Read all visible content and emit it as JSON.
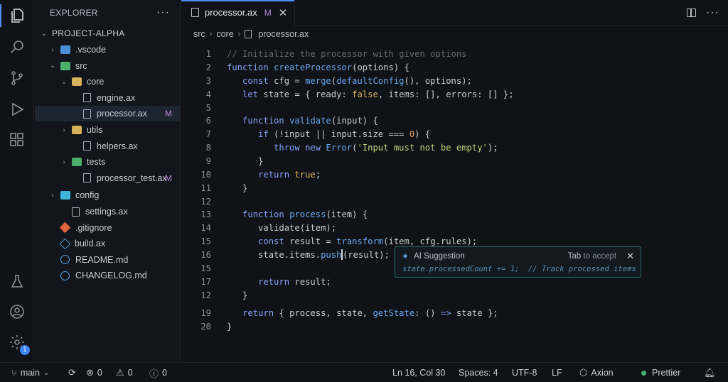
{
  "activity_bar": {
    "icons": [
      "files-icon",
      "search-icon",
      "source-control-icon",
      "run-debug-icon",
      "extensions-icon",
      "testing-icon",
      "account-icon",
      "settings-icon"
    ],
    "settings_badge": "1"
  },
  "sidebar": {
    "title": "EXPLORER",
    "more": "···",
    "project": "PROJECT-ALPHA",
    "items": [
      {
        "label": ".vscode",
        "kind": "folder",
        "color": "#4a90d9",
        "depth": 1,
        "open": false,
        "status": ""
      },
      {
        "label": "src",
        "kind": "folder",
        "color": "#4caf6a",
        "depth": 1,
        "open": true,
        "status": ""
      },
      {
        "label": "core",
        "kind": "folder",
        "color": "#d6b35a",
        "depth": 2,
        "open": true,
        "status": ""
      },
      {
        "label": "engine.ax",
        "kind": "file",
        "depth": 3,
        "status": ""
      },
      {
        "label": "processor.ax",
        "kind": "file",
        "depth": 3,
        "status": "M",
        "selected": true
      },
      {
        "label": "utils",
        "kind": "folder",
        "color": "#d6b35a",
        "depth": 2,
        "open": false,
        "status": ""
      },
      {
        "label": "helpers.ax",
        "kind": "file",
        "depth": 3,
        "status": ""
      },
      {
        "label": "tests",
        "kind": "folder",
        "color": "#4caf6a",
        "depth": 2,
        "open": false,
        "status": ""
      },
      {
        "label": "processor_test.ax",
        "kind": "file",
        "depth": 3,
        "status": "M"
      },
      {
        "label": "config",
        "kind": "folder",
        "color": "#3fb6d9",
        "depth": 1,
        "open": false,
        "status": ""
      },
      {
        "label": "settings.ax",
        "kind": "file",
        "depth": 2,
        "status": ""
      },
      {
        "label": ".gitignore",
        "kind": "git",
        "depth": 1,
        "status": ""
      },
      {
        "label": "build.ax",
        "kind": "build",
        "depth": 1,
        "status": ""
      },
      {
        "label": "README.md",
        "kind": "info",
        "depth": 1,
        "status": ""
      },
      {
        "label": "CHANGELOG.md",
        "kind": "info",
        "depth": 1,
        "status": ""
      }
    ]
  },
  "editor": {
    "tab": {
      "label": "processor.ax",
      "status": "M",
      "close": "✕"
    },
    "breadcrumb": [
      "src",
      "core",
      "processor.ax"
    ],
    "lines": [
      {
        "n": "1",
        "tokens": [
          [
            "com",
            "// Initialize the processor with given options"
          ]
        ]
      },
      {
        "n": "2",
        "tokens": [
          [
            "kw",
            "function "
          ],
          [
            "fn",
            "createProcessor"
          ],
          [
            "ct",
            "(options) {"
          ]
        ]
      },
      {
        "n": "3",
        "tokens": [
          [
            "ct",
            "   "
          ],
          [
            "kw",
            "const "
          ],
          [
            "ct",
            "cfg = "
          ],
          [
            "fn",
            "merge"
          ],
          [
            "ct",
            "("
          ],
          [
            "fn",
            "defaultConfig"
          ],
          [
            "ct",
            "(), options);"
          ]
        ]
      },
      {
        "n": "4",
        "tokens": [
          [
            "ct",
            "   "
          ],
          [
            "kw",
            "let "
          ],
          [
            "ct",
            "state = { ready: "
          ],
          [
            "bool",
            "false"
          ],
          [
            "ct",
            ", items: [], errors: [] };"
          ]
        ]
      },
      {
        "n": "5",
        "tokens": []
      },
      {
        "n": "6",
        "tokens": [
          [
            "ct",
            "   "
          ],
          [
            "kw",
            "function "
          ],
          [
            "fn",
            "validate"
          ],
          [
            "ct",
            "(input) {"
          ]
        ]
      },
      {
        "n": "7",
        "tokens": [
          [
            "ct",
            "      "
          ],
          [
            "kw",
            "if "
          ],
          [
            "ct",
            "(!input || input.size === "
          ],
          [
            "num",
            "0"
          ],
          [
            "ct",
            ") {"
          ]
        ]
      },
      {
        "n": "8",
        "tokens": [
          [
            "ct",
            "         "
          ],
          [
            "kw",
            "throw new "
          ],
          [
            "fn",
            "Error"
          ],
          [
            "ct",
            "("
          ],
          [
            "str",
            "'Input must not be empty'"
          ],
          [
            "ct",
            ");"
          ]
        ]
      },
      {
        "n": "9",
        "tokens": [
          [
            "ct",
            "      }"
          ]
        ]
      },
      {
        "n": "10",
        "tokens": [
          [
            "ct",
            "      "
          ],
          [
            "kw",
            "return "
          ],
          [
            "bool",
            "true"
          ],
          [
            "ct",
            ";"
          ]
        ]
      },
      {
        "n": "11",
        "tokens": [
          [
            "ct",
            "   }"
          ]
        ]
      },
      {
        "n": "12",
        "tokens": []
      },
      {
        "n": "13",
        "tokens": [
          [
            "ct",
            "   "
          ],
          [
            "kw",
            "function "
          ],
          [
            "fn",
            "process"
          ],
          [
            "ct",
            "(item) {"
          ]
        ]
      },
      {
        "n": "14",
        "tokens": [
          [
            "ct",
            "      validate(item);"
          ]
        ]
      },
      {
        "n": "15",
        "tokens": [
          [
            "ct",
            "      "
          ],
          [
            "kw",
            "const "
          ],
          [
            "ct",
            "result = "
          ],
          [
            "fn",
            "transform"
          ],
          [
            "ct",
            "(item, cfg.rules);"
          ]
        ]
      },
      {
        "n": "16",
        "tokens": [
          [
            "ct",
            "      state.items."
          ],
          [
            "fn",
            "push"
          ],
          [
            "cursor",
            ""
          ],
          [
            "ct",
            "(result);"
          ]
        ]
      },
      {
        "n": "15",
        "tokens": []
      },
      {
        "n": "17",
        "tokens": [
          [
            "ct",
            "      "
          ],
          [
            "kw",
            "return "
          ],
          [
            "ct",
            "result;"
          ]
        ]
      },
      {
        "n": "12",
        "tokens": [
          [
            "ct",
            "   }"
          ]
        ]
      },
      {
        "n": "19",
        "tokens": [
          [
            "ct",
            "   "
          ],
          [
            "kw",
            "return "
          ],
          [
            "ct",
            "{ process, state, "
          ],
          [
            "fn",
            "getState"
          ],
          [
            "ct",
            ": () "
          ],
          [
            "kw",
            "=> "
          ],
          [
            "ct",
            "state };"
          ]
        ]
      },
      {
        "n": "20",
        "tokens": [
          [
            "ct",
            "}"
          ]
        ]
      }
    ],
    "suggestion": {
      "title": "AI Suggestion",
      "hint_key": "Tab",
      "hint_text": " to accept",
      "close": "✕",
      "code": "state.processedCount += 1;  // Track processed items"
    }
  },
  "statusbar": {
    "branch": "main",
    "errors": "0",
    "warnings": "0",
    "info": "0",
    "position": "Ln 16, Col 30",
    "spaces": "Spaces: 4",
    "encoding": "UTF-8",
    "eol": "LF",
    "language": "Axion",
    "formatter": "Prettier"
  }
}
